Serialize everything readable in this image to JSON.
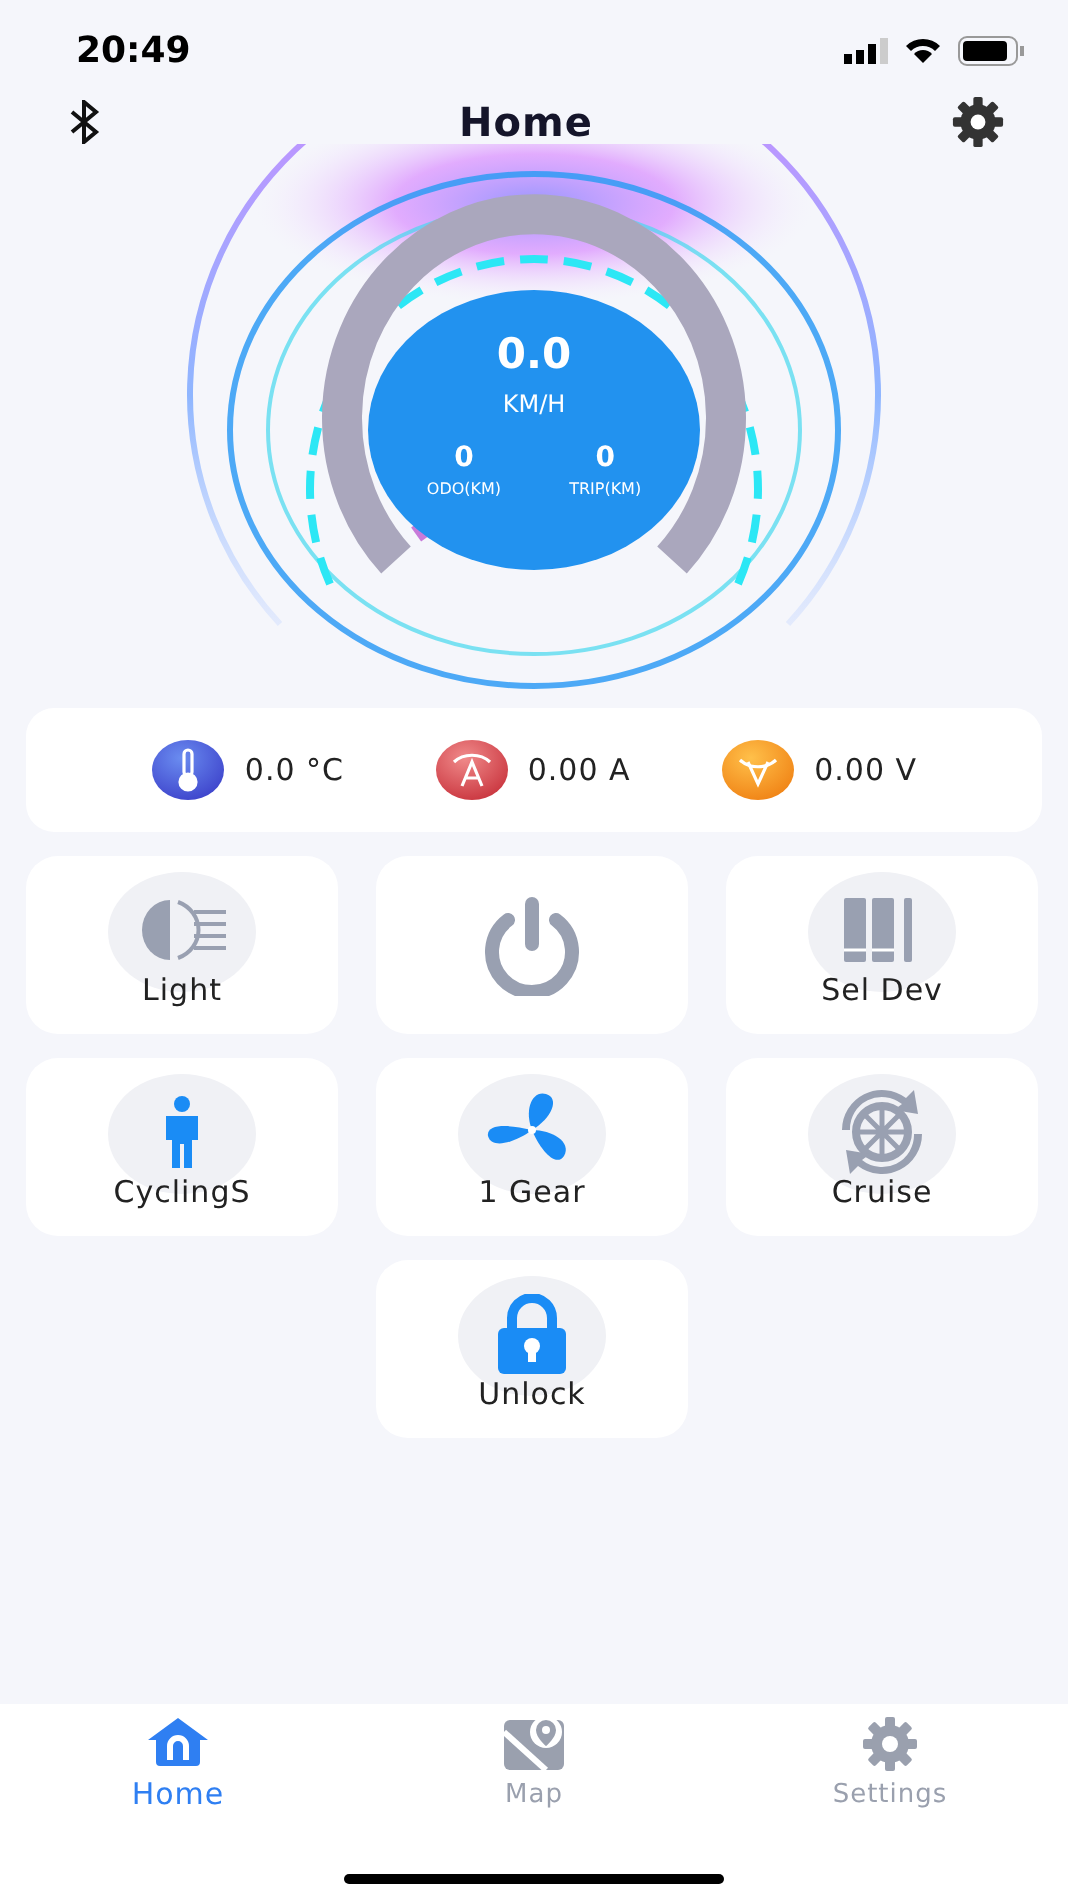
{
  "status_bar": {
    "time": "20:49"
  },
  "header": {
    "title": "Home"
  },
  "gauge": {
    "speed": "0.0",
    "unit": "KM/H",
    "odo": {
      "value": "0",
      "label": "ODO(KM)"
    },
    "trip": {
      "value": "0",
      "label": "TRIP(KM)"
    }
  },
  "sensors": [
    {
      "kind": "temperature",
      "reading": "0.0 °C"
    },
    {
      "kind": "current",
      "reading": "0.00 A"
    },
    {
      "kind": "voltage",
      "reading": "0.00 V"
    }
  ],
  "tiles": [
    {
      "kind": "light",
      "label": "Light",
      "on": false
    },
    {
      "kind": "power",
      "on": false
    },
    {
      "kind": "device",
      "label": "Sel Dev",
      "on": false
    },
    {
      "kind": "person",
      "label": "CyclingS",
      "on": true
    },
    {
      "kind": "fan",
      "label": "1 Gear",
      "on": true
    },
    {
      "kind": "cruise",
      "label": "Cruise",
      "on": false
    },
    {
      "kind": "lock",
      "label": "Unlock",
      "on": true
    }
  ],
  "tab_bar": [
    {
      "kind": "home",
      "label": "Home",
      "selected": true
    },
    {
      "kind": "map",
      "label": "Map",
      "selected": false
    },
    {
      "kind": "settings",
      "label": "Settings",
      "selected": false
    }
  ]
}
